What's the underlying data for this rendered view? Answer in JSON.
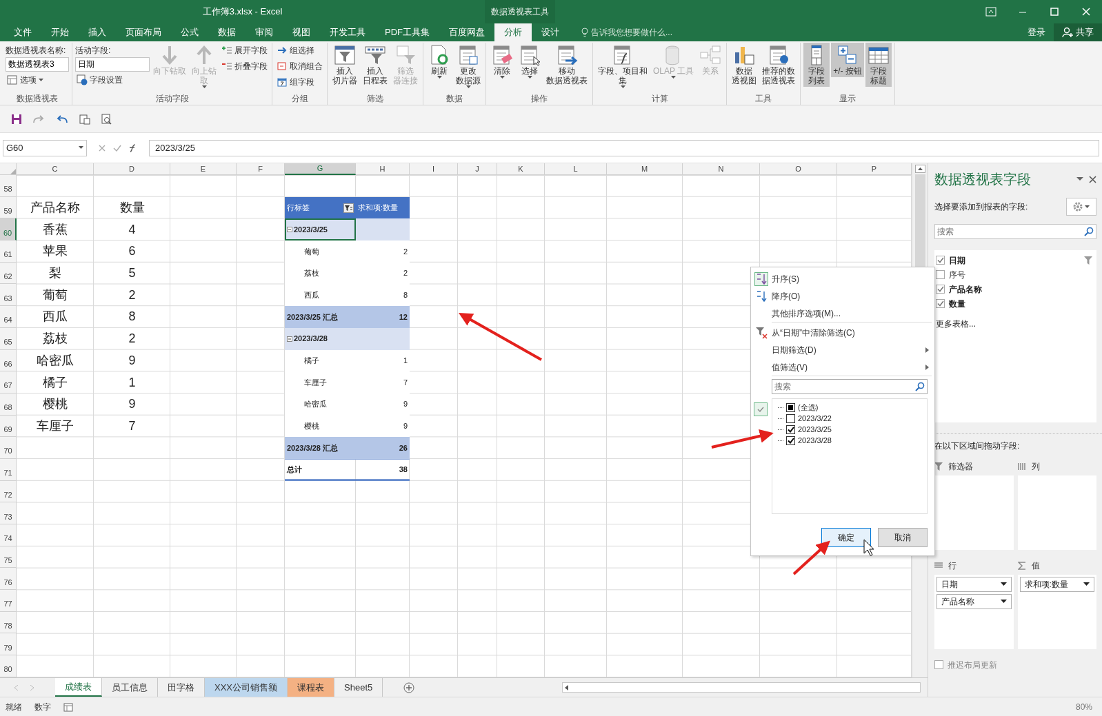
{
  "window": {
    "title": "工作簿3.xlsx - Excel",
    "context_title": "数据透视表工具"
  },
  "menu_tabs": [
    {
      "label": "文件",
      "selected": false
    },
    {
      "label": "开始",
      "selected": false
    },
    {
      "label": "插入",
      "selected": false
    },
    {
      "label": "页面布局",
      "selected": false
    },
    {
      "label": "公式",
      "selected": false
    },
    {
      "label": "数据",
      "selected": false
    },
    {
      "label": "审阅",
      "selected": false
    },
    {
      "label": "视图",
      "selected": false
    },
    {
      "label": "开发工具",
      "selected": false
    },
    {
      "label": "PDF工具集",
      "selected": false
    },
    {
      "label": "百度网盘",
      "selected": false
    },
    {
      "label": "分析",
      "selected": true
    },
    {
      "label": "设计",
      "selected": false
    }
  ],
  "tell_me": {
    "placeholder": "告诉我您想要做什么..."
  },
  "sign_in": "登录",
  "share": "共享",
  "ribbon": [
    {
      "label": "数据透视表",
      "columns": [
        [
          {
            "kind": "field",
            "label": "数据透视表名称:",
            "value": "数据透视表3"
          },
          {
            "kind": "small",
            "label": "选项",
            "dropdown": true
          }
        ]
      ]
    },
    {
      "label": "活动字段",
      "columns": [
        [
          {
            "kind": "field",
            "label": "活动字段:",
            "value": "日期"
          },
          {
            "kind": "small",
            "label": "字段设置"
          }
        ],
        [
          {
            "kind": "large",
            "lines": [
              "向下钻取"
            ],
            "disabled": true
          }
        ],
        [
          {
            "kind": "large",
            "lines": [
              "向上钻",
              "取"
            ],
            "disabled": true,
            "dropdown": true
          }
        ],
        [
          {
            "kind": "small",
            "label": "展开字段"
          },
          {
            "kind": "small",
            "label": "折叠字段"
          }
        ]
      ]
    },
    {
      "label": "分组",
      "columns": [
        [
          {
            "kind": "small",
            "label": "组选择"
          },
          {
            "kind": "small",
            "label": "取消组合"
          },
          {
            "kind": "small",
            "label": "组字段"
          }
        ]
      ]
    },
    {
      "label": "筛选",
      "columns": [
        [
          {
            "kind": "large",
            "lines": [
              "插入",
              "切片器"
            ]
          }
        ],
        [
          {
            "kind": "large",
            "lines": [
              "插入",
              "日程表"
            ]
          }
        ],
        [
          {
            "kind": "large",
            "lines": [
              "筛选",
              "器连接"
            ],
            "disabled": true
          }
        ]
      ]
    },
    {
      "label": "数据",
      "columns": [
        [
          {
            "kind": "large",
            "lines": [
              "刷新"
            ],
            "dropdown": true
          }
        ],
        [
          {
            "kind": "large",
            "lines": [
              "更改",
              "数据源"
            ],
            "dropdown": true
          }
        ]
      ]
    },
    {
      "label": "操作",
      "columns": [
        [
          {
            "kind": "large",
            "lines": [
              "清除"
            ],
            "dropdown": true
          }
        ],
        [
          {
            "kind": "large",
            "lines": [
              "选择"
            ],
            "dropdown": true
          }
        ],
        [
          {
            "kind": "large",
            "lines": [
              "移动",
              "数据透视表"
            ]
          }
        ]
      ]
    },
    {
      "label": "计算",
      "columns": [
        [
          {
            "kind": "large",
            "lines": [
              "字段、项目和",
              "集"
            ],
            "dropdown": true
          }
        ],
        [
          {
            "kind": "large",
            "lines": [
              "OLAP 工具"
            ],
            "disabled": true,
            "dropdown": true
          }
        ],
        [
          {
            "kind": "large",
            "lines": [
              "关系"
            ],
            "disabled": true
          }
        ]
      ]
    },
    {
      "label": "工具",
      "columns": [
        [
          {
            "kind": "large",
            "lines": [
              "数据",
              "透视图"
            ]
          }
        ],
        [
          {
            "kind": "large",
            "lines": [
              "推荐的数",
              "据透视表"
            ]
          }
        ]
      ]
    },
    {
      "label": "显示",
      "columns": [
        [
          {
            "kind": "large",
            "lines": [
              "字段",
              "列表"
            ],
            "pressed": true
          }
        ],
        [
          {
            "kind": "large",
            "lines": [
              "+/- 按钮"
            ],
            "pressed": true
          }
        ],
        [
          {
            "kind": "large",
            "lines": [
              "字段",
              "标题"
            ],
            "pressed": true
          }
        ]
      ]
    }
  ],
  "sheet": {
    "name_box": "G60",
    "formula": "2023/3/25",
    "columns": [
      {
        "label": "C",
        "selected": false
      },
      {
        "label": "D",
        "selected": false
      },
      {
        "label": "E",
        "selected": false
      },
      {
        "label": "F",
        "selected": false
      },
      {
        "label": "G",
        "selected": true
      },
      {
        "label": "H",
        "selected": false
      },
      {
        "label": "I",
        "selected": false
      },
      {
        "label": "J",
        "selected": false
      },
      {
        "label": "K",
        "selected": false
      },
      {
        "label": "L",
        "selected": false
      },
      {
        "label": "M",
        "selected": false
      },
      {
        "label": "N",
        "selected": false
      },
      {
        "label": "O",
        "selected": false
      },
      {
        "label": "P",
        "selected": false
      }
    ],
    "rows": [
      {
        "number": "58",
        "selected": false
      },
      {
        "number": "59",
        "selected": false,
        "c": "产品名称",
        "d": "数量",
        "pivot": {
          "kind": "header",
          "label": "行标签",
          "value": "求和项:数量",
          "selected": false
        }
      },
      {
        "number": "60",
        "selected": true,
        "c": "香蕉",
        "d": "4",
        "pivot": {
          "kind": "group",
          "label": "2023/3/25",
          "selected": true
        }
      },
      {
        "number": "61",
        "selected": false,
        "c": "苹果",
        "d": "6",
        "pivot": {
          "kind": "item",
          "label": "葡萄",
          "value": "2",
          "selected": false
        }
      },
      {
        "number": "62",
        "selected": false,
        "c": "梨",
        "d": "5",
        "pivot": {
          "kind": "item",
          "label": "荔枝",
          "value": "2",
          "selected": false
        }
      },
      {
        "number": "63",
        "selected": false,
        "c": "葡萄",
        "d": "2",
        "pivot": {
          "kind": "item",
          "label": "西瓜",
          "value": "8",
          "selected": false
        }
      },
      {
        "number": "64",
        "selected": false,
        "c": "西瓜",
        "d": "8",
        "pivot": {
          "kind": "subtotal",
          "label": "2023/3/25 汇总",
          "value": "12",
          "selected": false
        }
      },
      {
        "number": "65",
        "selected": false,
        "c": "荔枝",
        "d": "2",
        "pivot": {
          "kind": "group",
          "label": "2023/3/28",
          "selected": false
        }
      },
      {
        "number": "66",
        "selected": false,
        "c": "哈密瓜",
        "d": "9",
        "pivot": {
          "kind": "item",
          "label": "橘子",
          "value": "1",
          "selected": false
        }
      },
      {
        "number": "67",
        "selected": false,
        "c": "橘子",
        "d": "1",
        "pivot": {
          "kind": "item",
          "label": "车厘子",
          "value": "7",
          "selected": false
        }
      },
      {
        "number": "68",
        "selected": false,
        "c": "樱桃",
        "d": "9",
        "pivot": {
          "kind": "item",
          "label": "哈密瓜",
          "value": "9",
          "selected": false
        }
      },
      {
        "number": "69",
        "selected": false,
        "c": "车厘子",
        "d": "7",
        "pivot": {
          "kind": "item",
          "label": "樱桃",
          "value": "9",
          "selected": false
        }
      },
      {
        "number": "70",
        "selected": false,
        "pivot": {
          "kind": "subtotal",
          "label": "2023/3/28 汇总",
          "value": "26",
          "selected": false
        }
      },
      {
        "number": "71",
        "selected": false,
        "pivot": {
          "kind": "total",
          "label": "总计",
          "value": "38",
          "selected": false
        }
      },
      {
        "number": "72",
        "selected": false
      },
      {
        "number": "73",
        "selected": false
      },
      {
        "number": "74",
        "selected": false
      },
      {
        "number": "75",
        "selected": false
      },
      {
        "number": "76",
        "selected": false
      },
      {
        "number": "77",
        "selected": false
      },
      {
        "number": "78",
        "selected": false
      },
      {
        "number": "79",
        "selected": false
      },
      {
        "number": "80",
        "selected": false
      }
    ]
  },
  "filter_menu": {
    "items": [
      {
        "kind": "command",
        "label": "升序(S)"
      },
      {
        "kind": "command",
        "label": "降序(O)"
      },
      {
        "kind": "command",
        "label": "其他排序选项(M)..."
      },
      {
        "kind": "separator"
      },
      {
        "kind": "command",
        "label": "从“日期”中清除筛选(C)"
      },
      {
        "kind": "submenu",
        "label": "日期筛选(D)"
      },
      {
        "kind": "submenu",
        "label": "值筛选(V)"
      },
      {
        "kind": "separator"
      }
    ],
    "search": {
      "placeholder": "搜索"
    },
    "values": [
      {
        "label": "(全选)",
        "checked": false,
        "partial": true
      },
      {
        "label": "2023/3/22",
        "checked": false,
        "partial": false
      },
      {
        "label": "2023/3/25",
        "checked": true,
        "partial": false
      },
      {
        "label": "2023/3/28",
        "checked": true,
        "partial": false
      }
    ],
    "buttons": [
      {
        "label": "确定",
        "focused": true
      },
      {
        "label": "取消",
        "focused": false
      }
    ]
  },
  "field_pane": {
    "title": "数据透视表字段",
    "prompt": "选择要添加到报表的字段:",
    "search": {
      "placeholder": "搜索"
    },
    "fields": [
      {
        "label": "日期",
        "checked": true,
        "filtered": true
      },
      {
        "label": "序号",
        "checked": false,
        "filtered": false
      },
      {
        "label": "产品名称",
        "checked": true,
        "filtered": false
      },
      {
        "label": "数量",
        "checked": true,
        "filtered": false
      }
    ],
    "more": "更多表格...",
    "areas_prompt": "在以下区域间拖动字段:",
    "areas": [
      {
        "kind": "filters",
        "label": "筛选器"
      },
      {
        "kind": "columns",
        "label": "列"
      },
      {
        "kind": "rows",
        "label": "行",
        "chips": [
          "日期",
          "产品名称"
        ]
      },
      {
        "kind": "values",
        "label": "值",
        "chips": [
          "求和项:数量"
        ]
      }
    ],
    "defer": {
      "label": "推迟布局更新",
      "checked": false
    }
  },
  "sheet_tabs": [
    {
      "label": "成绩表",
      "selected": true
    },
    {
      "label": "员工信息",
      "selected": false
    },
    {
      "label": "田字格",
      "selected": false
    },
    {
      "label": "XXX公司销售额",
      "selected": false,
      "color": "#bdd7ee"
    },
    {
      "label": "课程表",
      "selected": false,
      "color": "#f4b183"
    },
    {
      "label": "Sheet5",
      "selected": false
    }
  ],
  "status": [
    "就绪",
    "数字"
  ],
  "zoom": "80%"
}
